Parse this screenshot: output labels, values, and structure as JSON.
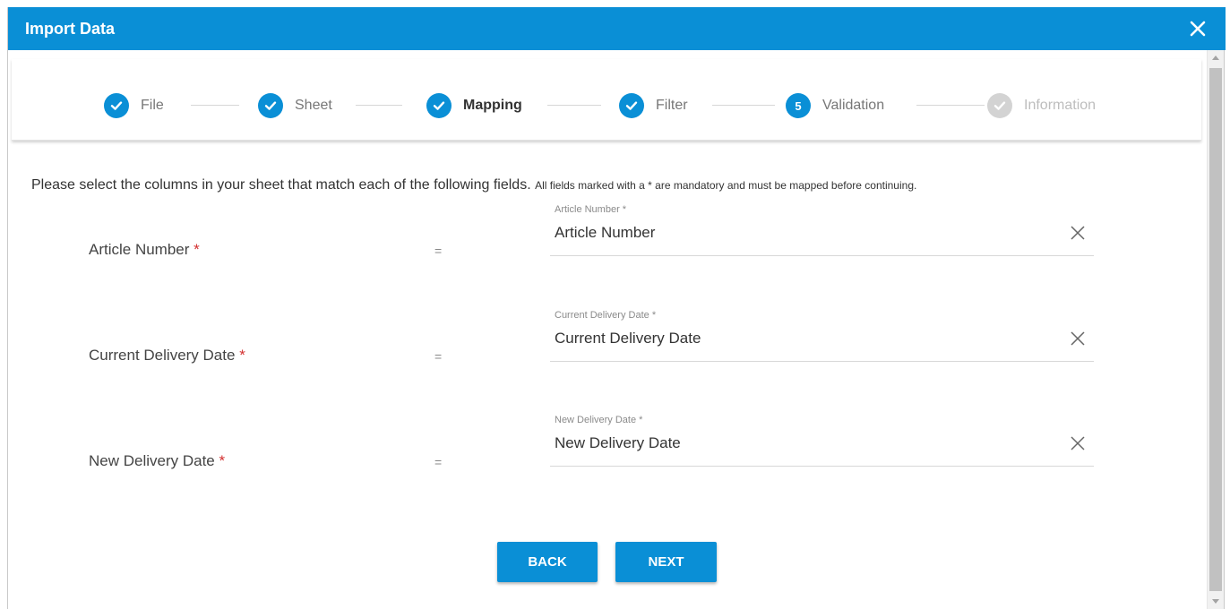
{
  "colors": {
    "primary": "#0a8fd6",
    "step_done": "#0a8fd6",
    "step_disabled": "#d0d0d0",
    "required": "#d32f2f"
  },
  "dialog": {
    "title": "Import Data",
    "close_icon": "close-icon"
  },
  "stepper": {
    "steps": [
      {
        "label": "File",
        "state": "done",
        "icon": "check-icon"
      },
      {
        "label": "Sheet",
        "state": "done",
        "icon": "check-icon"
      },
      {
        "label": "Mapping",
        "state": "active",
        "icon": "check-icon"
      },
      {
        "label": "Filter",
        "state": "done",
        "icon": "check-icon"
      },
      {
        "label": "Validation",
        "state": "numbered",
        "number": "5"
      },
      {
        "label": "Information",
        "state": "disabled",
        "icon": "check-icon"
      }
    ]
  },
  "instruction": {
    "main": "Please select the columns in your sheet that match each of the following fields.",
    "note": "All fields marked with a * are mandatory and must be mapped before continuing."
  },
  "mappings": [
    {
      "label": "Article Number",
      "required_mark": "*",
      "equals": "=",
      "field_label": "Article Number *",
      "field_value": "Article Number"
    },
    {
      "label": "Current Delivery Date",
      "required_mark": "*",
      "equals": "=",
      "field_label": "Current Delivery Date *",
      "field_value": "Current Delivery Date"
    },
    {
      "label": "New Delivery Date",
      "required_mark": "*",
      "equals": "=",
      "field_label": "New Delivery Date *",
      "field_value": "New Delivery Date"
    }
  ],
  "buttons": {
    "back": "BACK",
    "next": "NEXT"
  }
}
